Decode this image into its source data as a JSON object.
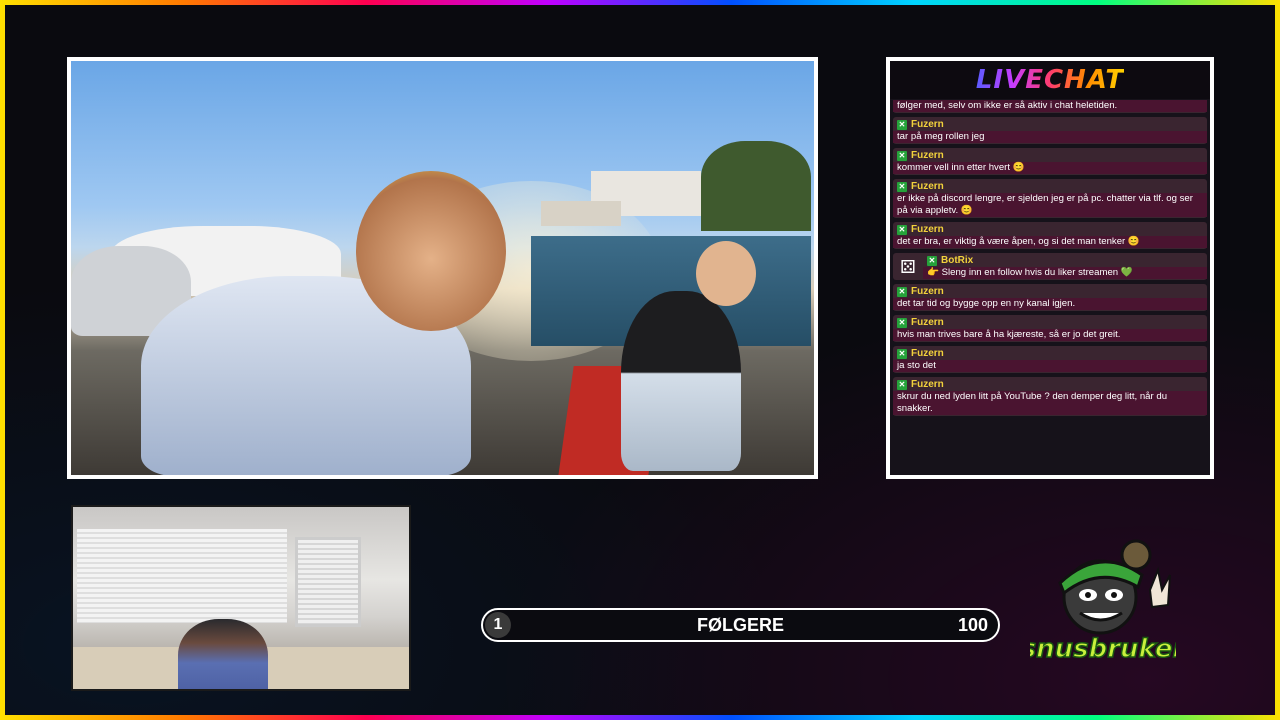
{
  "chat": {
    "title": "LIVECHAT",
    "messages": [
      {
        "user": "",
        "text": "følger med, selv om ikke er så aktiv i chat heletiden."
      },
      {
        "user": "Fuzern",
        "text": "tar på meg rollen jeg"
      },
      {
        "user": "Fuzern",
        "text": "kommer vell inn etter hvert 😊"
      },
      {
        "user": "Fuzern",
        "text": "er ikke på discord lengre, er sjelden jeg er på pc. chatter via tlf. og ser på via appletv. 😊"
      },
      {
        "user": "Fuzern",
        "text": "det er bra, er viktig å være åpen, og si det man tenker 😊"
      },
      {
        "user": "BotRix",
        "text": "👉 Sleng inn en follow hvis du liker streamen 💚"
      },
      {
        "user": "Fuzern",
        "text": "det tar tid og bygge opp en ny kanal igjen."
      },
      {
        "user": "Fuzern",
        "text": "hvis man trives bare å ha kjæreste, så er jo det greit."
      },
      {
        "user": "Fuzern",
        "text": "ja sto det"
      },
      {
        "user": "Fuzern",
        "text": "skrur du ned lyden litt på YouTube ? den demper deg litt, når du snakker."
      }
    ]
  },
  "followers": {
    "label": "FØLGERE",
    "current": "1",
    "goal": "100",
    "progress": 0.01
  },
  "logo": {
    "text": "snusbruker"
  },
  "colors": {
    "username": "#f2d23c",
    "badge": "#25a23a",
    "message_bg": "#4a1430"
  }
}
